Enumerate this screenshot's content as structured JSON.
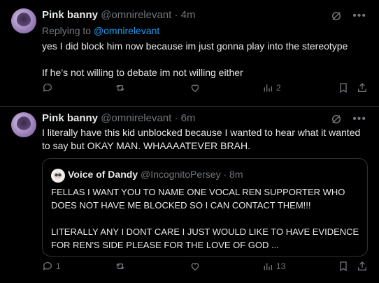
{
  "tweets": [
    {
      "name": "Pink banny",
      "handle": "@omnirelevant",
      "dot": "·",
      "time": "4m",
      "replying_prefix": "Replying to",
      "replying_handle": "@omnirelevant",
      "text_line1": "yes I did block him now because im just gonna play into the stereotype",
      "text_line2": "If he’s not willing to debate im not willing either",
      "actions": {
        "replies": "",
        "reposts": "",
        "likes": "",
        "views": "2"
      }
    },
    {
      "name": "Pink banny",
      "handle": "@omnirelevant",
      "dot": "·",
      "time": "6m",
      "text": "I literally have this kid unblocked because I wanted to hear what it wanted to say but OKAY MAN. WHAAAATEVER BRAH.",
      "quote": {
        "name": "Voice of Dandy",
        "handle": "@IncognitoPersey",
        "dot": "·",
        "time": "8m",
        "para1": "FELLAS I WANT YOU TO NAME ONE VOCAL REN SUPPORTER WHO DOES NOT HAVE ME BLOCKED SO I CAN CONTACT THEM!!!",
        "para2": "LITERALLY ANY I DONT CARE I JUST WOULD LIKE TO HAVE EVIDENCE FOR REN'S SIDE PLEASE FOR THE LOVE OF GOD ..."
      },
      "actions": {
        "replies": "1",
        "reposts": "",
        "likes": "",
        "views": "13"
      }
    }
  ],
  "icons": [
    "reply-icon",
    "repost-icon",
    "like-icon",
    "views-icon",
    "bookmark-icon",
    "share-icon",
    "grok-icon",
    "more-icon"
  ],
  "colors": {
    "background": "#000000",
    "text": "#e7e9ea",
    "muted": "#71767b",
    "link": "#1d9bf0",
    "border": "#2f3336"
  }
}
